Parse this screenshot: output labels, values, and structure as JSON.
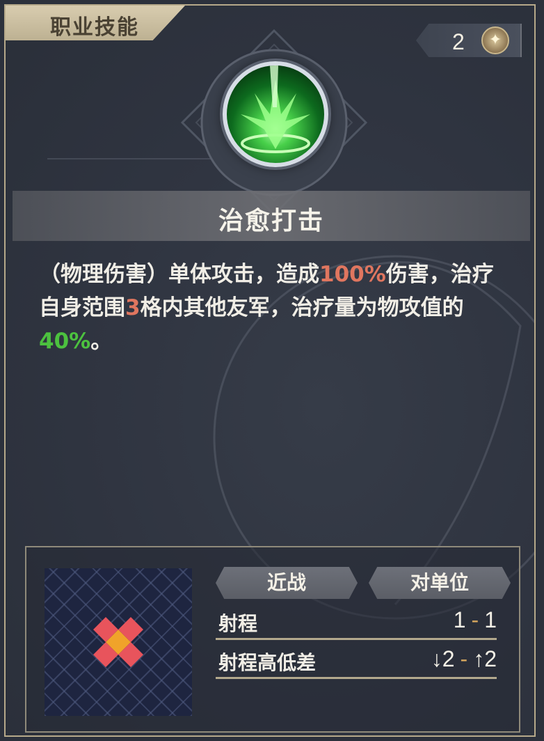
{
  "header": {
    "tab_label": "职业技能",
    "cost_value": "2",
    "cost_icon": "star-gem-icon"
  },
  "skill": {
    "icon": "green-healing-strike-icon",
    "name": "治愈打击",
    "desc_parts": {
      "p1": "（物理伤害）单体攻击，造成",
      "v1": "100%",
      "p2": "伤害，治疗自身范围",
      "v2": "3",
      "p3": "格内其他友军，治疗量为物攻值的",
      "v3": "40%",
      "p4": "。"
    }
  },
  "info": {
    "tag_range_type": "近战",
    "tag_target_type": "对单位",
    "range_label": "射程",
    "range_min": "1",
    "range_sep": "-",
    "range_max": "1",
    "height_label": "射程高低差",
    "height_down": "2",
    "height_sep": "-",
    "height_up": "2"
  },
  "colors": {
    "highlight_damage": "#e0765f",
    "highlight_heal": "#4cc13f",
    "tab_bg": "#d8ccaf"
  }
}
